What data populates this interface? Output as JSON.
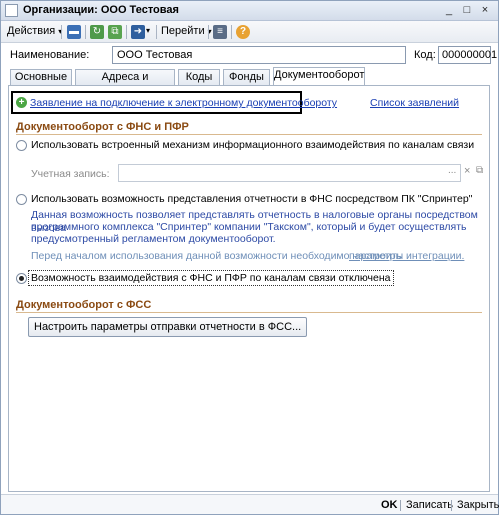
{
  "window": {
    "title": "Организации: ООО Тестовая",
    "buttons": {
      "minimize": "_",
      "maximize": "□",
      "close": "×"
    }
  },
  "toolbar": {
    "actions_label": "Действия",
    "goto_label": "Перейти",
    "help_label": "?"
  },
  "form": {
    "name_label": "Наименование:",
    "name_value": "ООО Тестовая",
    "code_label": "Код:",
    "code_value": "000000001"
  },
  "tabs": [
    {
      "label": "Основные"
    },
    {
      "label": "Адреса и телефоны"
    },
    {
      "label": "Коды"
    },
    {
      "label": "Фонды"
    },
    {
      "label": "Документооборот"
    }
  ],
  "docflow": {
    "application_link": "Заявление на подключение к электронному документообороту",
    "applications_list_link": "Список заявлений",
    "fns_section_title": "Документооборот с ФНС и ПФР",
    "option_builtin": "Использовать встроенный механизм информационного взаимодействия по каналам связи",
    "account_label": "Учетная запись:",
    "account_value": "",
    "option_sprinter": "Использовать возможность представления отчетности в ФНС посредством ПК \"Спринтер\"",
    "sprinter_desc_1": "Данная возможность позволяет представлять отчетность в налоговые органы посредством вызова",
    "sprinter_desc_2": "программного комплекса \"Спринтер\" компании \"Такском\", который и будет осуществлять",
    "sprinter_desc_3": "предусмотренный регламентом документооборот.",
    "sprinter_note": "Перед началом использования данной возможности необходимо настроить",
    "integration_link": "параметры интеграции.",
    "option_disabled": "Возможность взаимодействия с ФНС и ПФР по каналам связи отключена",
    "fss_section_title": "Документооборот с ФСС",
    "fss_button": "Настроить параметры отправки отчетности в ФСС..."
  },
  "bottombar": {
    "ok_label": "OK",
    "save_label": "Записать",
    "close_label": "Закрыть"
  }
}
